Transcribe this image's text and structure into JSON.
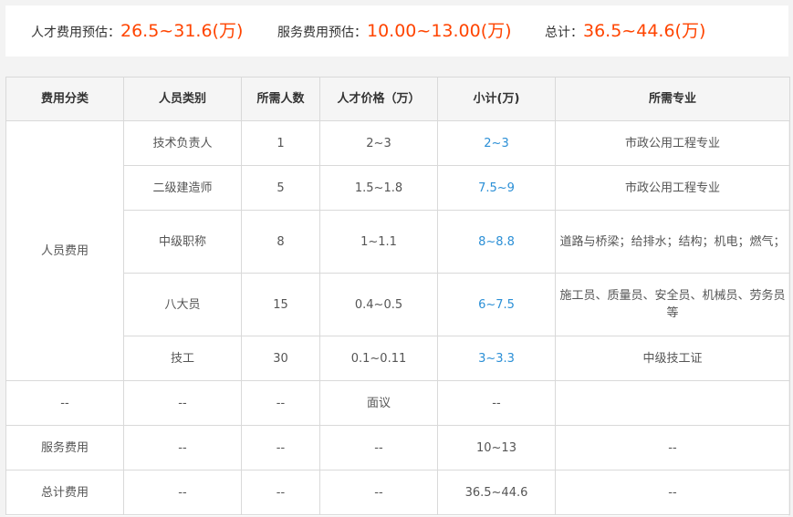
{
  "summary": {
    "talent_label": "人才费用预估：",
    "talent_value": "26.5~31.6(万)",
    "service_label": "服务费用预估：",
    "service_value": "10.00~13.00(万)",
    "total_label": "总计：",
    "total_value": "36.5~44.6(万)"
  },
  "colors": {
    "accent": "#ff4400",
    "link_blue": "#2b8fd6",
    "border": "#d9d9d9",
    "header_bg": "#f5f5f5"
  },
  "table": {
    "headers": [
      "费用分类",
      "人员类别",
      "所需人数",
      "人才价格（万）",
      "小计(万)",
      "所需专业"
    ],
    "personnel_category": "人员费用",
    "personnel_rows": [
      {
        "type": "技术负责人",
        "count": "1",
        "price": "2~3",
        "subtotal": "2~3",
        "major": "市政公用工程专业"
      },
      {
        "type": "二级建造师",
        "count": "5",
        "price": "1.5~1.8",
        "subtotal": "7.5~9",
        "major": "市政公用工程专业"
      },
      {
        "type": "中级职称",
        "count": "8",
        "price": "1~1.1",
        "subtotal": "8~8.8",
        "major": "道路与桥梁；给排水；结构；机电；燃气；"
      },
      {
        "type": "八大员",
        "count": "15",
        "price": "0.4~0.5",
        "subtotal": "6~7.5",
        "major": "施工员、质量员、安全员、机械员、劳务员等"
      },
      {
        "type": "技工",
        "count": "30",
        "price": "0.1~0.11",
        "subtotal": "3~3.3",
        "major": "中级技工证"
      }
    ],
    "negotiable_row": {
      "category": "--",
      "type": "--",
      "count": "--",
      "price": "面议",
      "subtotal": "--",
      "major": ""
    },
    "service_row": {
      "category": "服务费用",
      "type": "--",
      "count": "--",
      "price": "--",
      "subtotal": "10~13",
      "major": "--"
    },
    "total_row": {
      "category": "总计费用",
      "type": "--",
      "count": "--",
      "price": "--",
      "subtotal": "36.5~44.6",
      "major": "--"
    }
  }
}
